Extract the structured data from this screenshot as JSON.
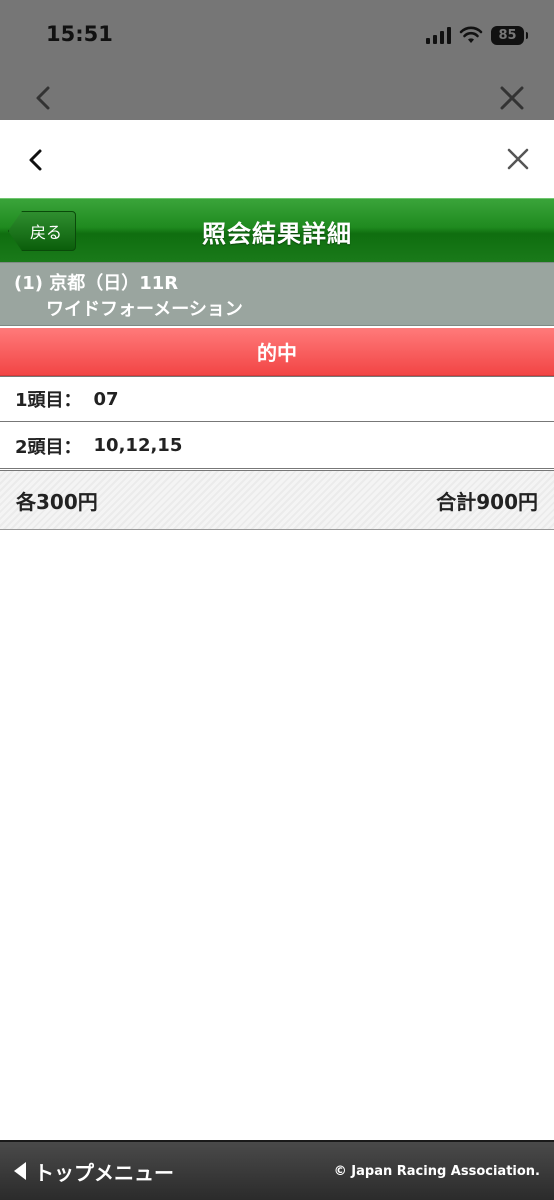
{
  "status_bar": {
    "time": "15:51",
    "battery": "85"
  },
  "header": {
    "back_label": "戻る",
    "title": "照会結果詳細"
  },
  "race": {
    "line1": "(1) 京都（日）11R",
    "line2": "ワイドフォーメーション"
  },
  "result": {
    "label": "的中"
  },
  "selections": [
    {
      "label": "1頭目：",
      "value": "07"
    },
    {
      "label": "2頭目：",
      "value": "10,12,15"
    }
  ],
  "amounts": {
    "each": "各300円",
    "total": "合計900円"
  },
  "footer": {
    "top_menu": "トップメニュー",
    "copyright": "© Japan Racing Association."
  },
  "colors": {
    "title_bar_green": "#1f8a1f",
    "race_info_gray": "#9aa59f",
    "hit_red": "#f24545",
    "footer_dark": "#2b2b2b"
  }
}
